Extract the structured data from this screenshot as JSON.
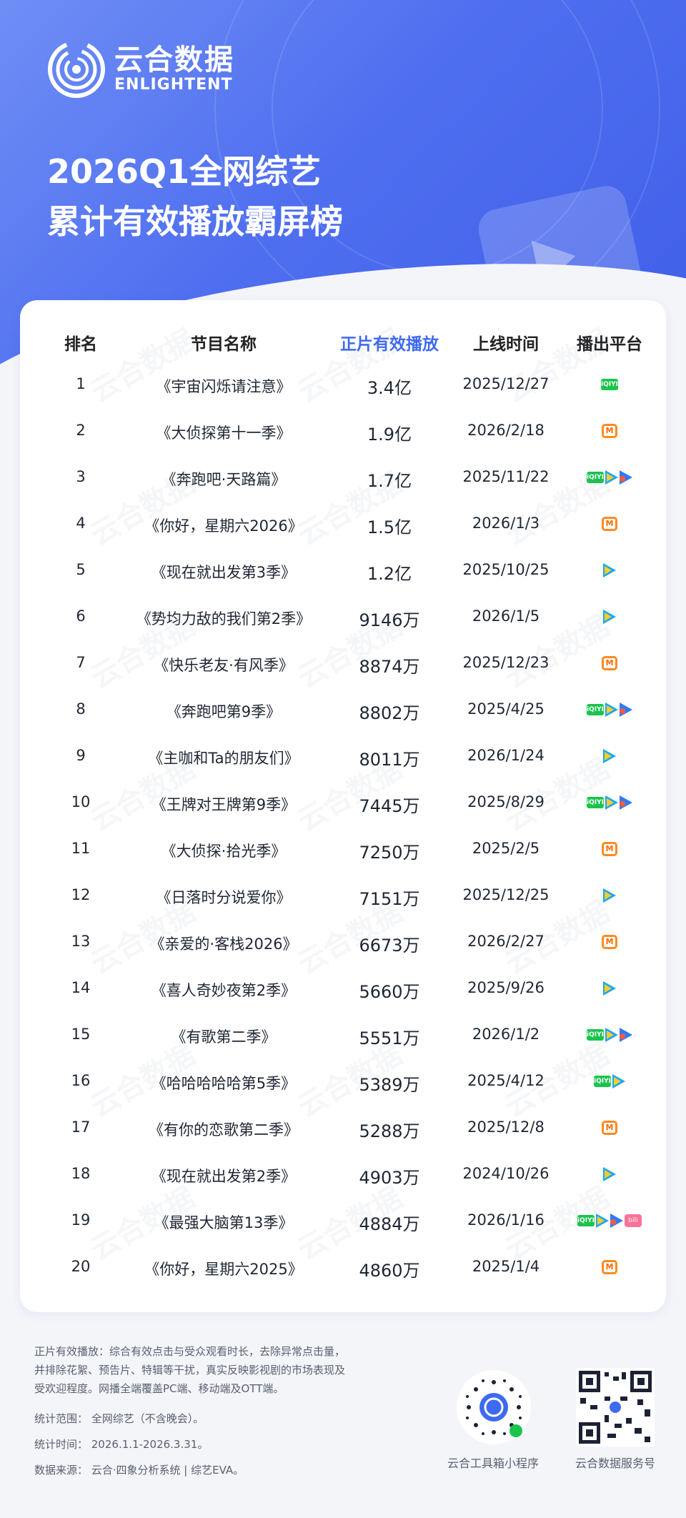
{
  "brand": {
    "name_cn": "云合数据",
    "name_en": "ENLIGHTENT"
  },
  "title": {
    "line1": "2026Q1全网综艺",
    "line2": "累计有效播放霸屏榜"
  },
  "table": {
    "headers": [
      "排名",
      "节目名称",
      "正片有效播放",
      "上线时间",
      "播出平台"
    ],
    "rows": [
      {
        "rank": "1",
        "name": "《宇宙闪烁请注意》",
        "value": "3.4亿",
        "date": "2025/12/27",
        "platforms": [
          "iqiyi"
        ]
      },
      {
        "rank": "2",
        "name": "《大侦探第十一季》",
        "value": "1.9亿",
        "date": "2026/2/18",
        "platforms": [
          "mgtv"
        ]
      },
      {
        "rank": "3",
        "name": "《奔跑吧·天路篇》",
        "value": "1.7亿",
        "date": "2025/11/22",
        "platforms": [
          "iqiyi",
          "tencent",
          "youku"
        ]
      },
      {
        "rank": "4",
        "name": "《你好，星期六2026》",
        "value": "1.5亿",
        "date": "2026/1/3",
        "platforms": [
          "mgtv"
        ]
      },
      {
        "rank": "5",
        "name": "《现在就出发第3季》",
        "value": "1.2亿",
        "date": "2025/10/25",
        "platforms": [
          "tencent"
        ]
      },
      {
        "rank": "6",
        "name": "《势均力敌的我们第2季》",
        "value": "9146万",
        "date": "2026/1/5",
        "platforms": [
          "tencent"
        ]
      },
      {
        "rank": "7",
        "name": "《快乐老友·有风季》",
        "value": "8874万",
        "date": "2025/12/23",
        "platforms": [
          "mgtv"
        ]
      },
      {
        "rank": "8",
        "name": "《奔跑吧第9季》",
        "value": "8802万",
        "date": "2025/4/25",
        "platforms": [
          "iqiyi",
          "tencent",
          "youku"
        ]
      },
      {
        "rank": "9",
        "name": "《主咖和Ta的朋友们》",
        "value": "8011万",
        "date": "2026/1/24",
        "platforms": [
          "tencent"
        ]
      },
      {
        "rank": "10",
        "name": "《王牌对王牌第9季》",
        "value": "7445万",
        "date": "2025/8/29",
        "platforms": [
          "iqiyi",
          "tencent",
          "youku"
        ]
      },
      {
        "rank": "11",
        "name": "《大侦探·拾光季》",
        "value": "7250万",
        "date": "2025/2/5",
        "platforms": [
          "mgtv"
        ]
      },
      {
        "rank": "12",
        "name": "《日落时分说爱你》",
        "value": "7151万",
        "date": "2025/12/25",
        "platforms": [
          "tencent"
        ]
      },
      {
        "rank": "13",
        "name": "《亲爱的·客栈2026》",
        "value": "6673万",
        "date": "2026/2/27",
        "platforms": [
          "mgtv"
        ]
      },
      {
        "rank": "14",
        "name": "《喜人奇妙夜第2季》",
        "value": "5660万",
        "date": "2025/9/26",
        "platforms": [
          "tencent"
        ]
      },
      {
        "rank": "15",
        "name": "《有歌第二季》",
        "value": "5551万",
        "date": "2026/1/2",
        "platforms": [
          "iqiyi",
          "tencent",
          "youku"
        ]
      },
      {
        "rank": "16",
        "name": "《哈哈哈哈哈第5季》",
        "value": "5389万",
        "date": "2025/4/12",
        "platforms": [
          "iqiyi",
          "tencent"
        ]
      },
      {
        "rank": "17",
        "name": "《有你的恋歌第二季》",
        "value": "5288万",
        "date": "2025/12/8",
        "platforms": [
          "mgtv"
        ]
      },
      {
        "rank": "18",
        "name": "《现在就出发第2季》",
        "value": "4903万",
        "date": "2024/10/26",
        "platforms": [
          "tencent"
        ]
      },
      {
        "rank": "19",
        "name": "《最强大脑第13季》",
        "value": "4884万",
        "date": "2026/1/16",
        "platforms": [
          "iqiyi",
          "tencent",
          "youku",
          "bilibili"
        ]
      },
      {
        "rank": "20",
        "name": "《你好，星期六2025》",
        "value": "4860万",
        "date": "2025/1/4",
        "platforms": [
          "mgtv"
        ]
      }
    ]
  },
  "platform_labels": {
    "iqiyi": "iQIYI",
    "mgtv": "M",
    "bilibili": "bili"
  },
  "colors": {
    "accent": "#3d6af0",
    "iqiyi": "#19c44c",
    "tencent": "#1aa8f0",
    "youku": "#2f7bf7",
    "mgtv": "#ff8a1e",
    "bilibili": "#fb7299"
  },
  "footer": {
    "note1": "正片有效播放：综合有效点击与受众观看时长，去除异常点击量，",
    "note2": "并排除花絮、预告片、特辑等干扰，真实反映影视剧的市场表现及",
    "note3": "受欢迎程度。网播全端覆盖PC端、移动端及OTT端。",
    "scope": "统计范围：   全网综艺（不含晚会）。",
    "period": "统计时间：   2026.1.1-2026.3.31。",
    "source": "数据来源：   云合·四象分析系统 | 综艺EVA。",
    "qr1_label": "云合工具箱小程序",
    "qr2_label": "云合数据服务号"
  }
}
